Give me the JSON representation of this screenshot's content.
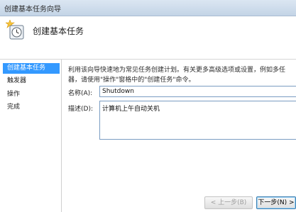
{
  "window": {
    "title": "创建基本任务向导"
  },
  "header": {
    "title": "创建基本任务",
    "icon": "wizard-clock-icon"
  },
  "sidebar": {
    "steps": [
      {
        "label": "创建基本任务",
        "active": true
      },
      {
        "label": "触发器",
        "active": false
      },
      {
        "label": "操作",
        "active": false
      },
      {
        "label": "完成",
        "active": false
      }
    ]
  },
  "main": {
    "description_line1": "利用该向导快速地为常见任务创建计划。有关更多高级选项或设置，例如多任",
    "description_line2": "器，请使用\"操作\"窗格中的\"创建任务\"命令。",
    "name_label": "名称(A):",
    "name_value": "Shutdown",
    "desc_label": "描述(D):",
    "desc_value": "计算机上午自动关机"
  },
  "buttons": {
    "back_label": "< 上一步(B)",
    "next_label": "下一步(N) >"
  },
  "colors": {
    "active_step": "#3399ff",
    "dialog_bg": "#ffffff"
  }
}
